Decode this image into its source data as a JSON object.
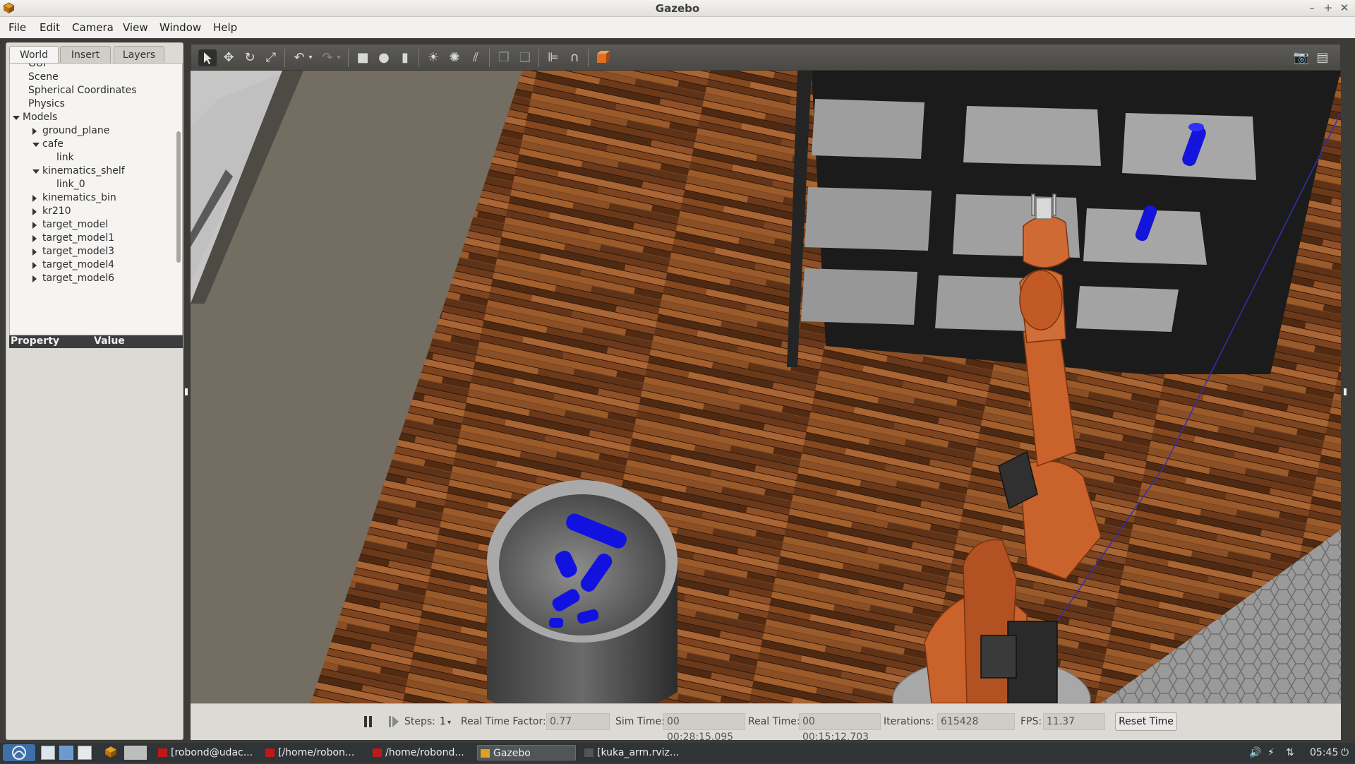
{
  "window": {
    "title": "Gazebo"
  },
  "window_controls": {
    "minimize": "–",
    "maximize": "+",
    "close": "✕"
  },
  "menubar": {
    "items": [
      "File",
      "Edit",
      "Camera",
      "View",
      "Window",
      "Help"
    ]
  },
  "left_panel": {
    "tabs": [
      "World",
      "Insert",
      "Layers"
    ],
    "active_tab": "World",
    "tree": [
      {
        "label": "GUI",
        "level": 1,
        "toggle": "none"
      },
      {
        "label": "Scene",
        "level": 1,
        "toggle": "none"
      },
      {
        "label": "Spherical Coordinates",
        "level": 1,
        "toggle": "none"
      },
      {
        "label": "Physics",
        "level": 1,
        "toggle": "none"
      },
      {
        "label": "Models",
        "level": 0,
        "toggle": "down"
      },
      {
        "label": "ground_plane",
        "level": 2,
        "toggle": "right"
      },
      {
        "label": "cafe",
        "level": 2,
        "toggle": "down"
      },
      {
        "label": "link",
        "level": 3,
        "toggle": "none"
      },
      {
        "label": "kinematics_shelf",
        "level": 2,
        "toggle": "down"
      },
      {
        "label": "link_0",
        "level": 3,
        "toggle": "none"
      },
      {
        "label": "kinematics_bin",
        "level": 2,
        "toggle": "right"
      },
      {
        "label": "kr210",
        "level": 2,
        "toggle": "right"
      },
      {
        "label": "target_model",
        "level": 2,
        "toggle": "right"
      },
      {
        "label": "target_model1",
        "level": 2,
        "toggle": "right"
      },
      {
        "label": "target_model3",
        "level": 2,
        "toggle": "right"
      },
      {
        "label": "target_model4",
        "level": 2,
        "toggle": "right"
      },
      {
        "label": "target_model6",
        "level": 2,
        "toggle": "right"
      }
    ],
    "property_header": {
      "property": "Property",
      "value": "Value"
    }
  },
  "toolbar": {
    "icons": [
      "select-arrow-icon",
      "translate-icon",
      "rotate-icon",
      "scale-icon",
      "undo-icon",
      "undo-dropdown-icon",
      "redo-icon",
      "redo-dropdown-icon",
      "box-shape-icon",
      "sphere-shape-icon",
      "cylinder-shape-icon",
      "point-light-icon",
      "spot-light-icon",
      "directional-light-icon",
      "copy-icon",
      "paste-icon",
      "align-icon",
      "snap-magnet-icon",
      "view-angle-icon"
    ],
    "right_icons": [
      "screenshot-camera-icon",
      "log-recorder-icon"
    ]
  },
  "bottom_bar": {
    "steps_label": "Steps:",
    "steps_value": "1",
    "rtf_label": "Real Time Factor:",
    "rtf_value": "0.77",
    "sim_time_label": "Sim Time:",
    "sim_time_value": "00 00:28:15.095",
    "real_time_label": "Real Time:",
    "real_time_value": "00 00:15:12.703",
    "iterations_label": "Iterations:",
    "iterations_value": "615428",
    "fps_label": "FPS:",
    "fps_value": "11.37",
    "reset_label": "Reset Time"
  },
  "taskbar": {
    "tasks": [
      "[robond@udac...",
      "[/home/robon...",
      "/home/robond...",
      "Gazebo",
      "[kuka_arm.rviz..."
    ],
    "active_task": "Gazebo",
    "clock": "05:45"
  },
  "colors": {
    "robot": "#c9622b",
    "target_objects": "#1212e0",
    "shelf": "#1e1e1e",
    "floor_wood": "#7a4320",
    "toolbar": "#52514d"
  }
}
